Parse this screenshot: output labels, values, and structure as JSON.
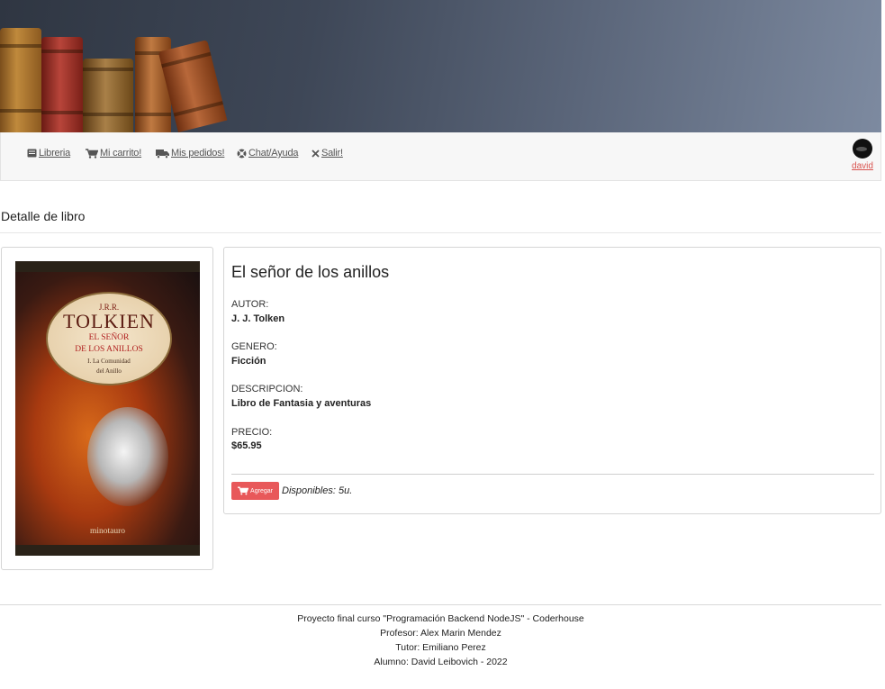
{
  "navbar": {
    "items": [
      {
        "label": "Libreria",
        "icon": "book-icon"
      },
      {
        "label": "Mi carrito!",
        "icon": "cart-icon"
      },
      {
        "label": "Mis pedidos!",
        "icon": "truck-icon"
      },
      {
        "label": "Chat/Ayuda",
        "icon": "help-circle-icon"
      },
      {
        "label": "Salir!",
        "icon": "close-icon"
      }
    ],
    "user": {
      "name": "david"
    }
  },
  "page": {
    "title": "Detalle de libro"
  },
  "book": {
    "title": "El señor de los anillos",
    "fields": [
      {
        "label": "AUTOR:",
        "value": "J. J. Tolken"
      },
      {
        "label": "GENERO:",
        "value": "Ficción"
      },
      {
        "label": "DESCRIPCION:",
        "value": "Libro de Fantasia y aventuras"
      },
      {
        "label": "PRECIO:",
        "value": "$65.95"
      }
    ],
    "add_button_label": "Agregar",
    "stock_text": "Disponibles: 5u.",
    "cover": {
      "author_initials": "J.R.R.",
      "author": "TOLKIEN",
      "series_line1": "EL SEÑOR",
      "series_line2": "DE LOS ANILLOS",
      "volume_line1": "I. La Comunidad",
      "volume_line2": "del Anillo",
      "publisher": "minotauro"
    }
  },
  "footer": {
    "lines": [
      "Proyecto final curso \"Programación Backend NodeJS\" - Coderhouse",
      "Profesor: Alex Marin Mendez",
      "Tutor: Emiliano Perez",
      "Alumno: David Leibovich - 2022"
    ]
  },
  "colors": {
    "accent": "#e8585a",
    "user_link": "#d9534f",
    "navbar_bg": "#f7f7f7"
  }
}
